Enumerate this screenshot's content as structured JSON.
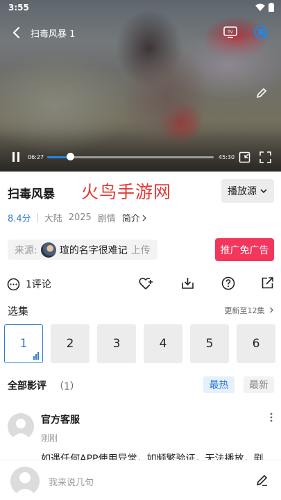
{
  "status": {
    "time": "3:55"
  },
  "player": {
    "title": "扫毒风暴 1",
    "current_time": "06:27",
    "duration": "45:30",
    "progress": 0.14
  },
  "show": {
    "title": "扫毒风暴",
    "watermark": "火鸟手游网",
    "source_button": "播放源",
    "score": "8.4分",
    "region": "大陆",
    "year": "2025",
    "genre": "剧情",
    "intro": "简介"
  },
  "uploader": {
    "label": "来源:",
    "name": "瑄的名字很难记",
    "suffix": "上传",
    "promo_button": "推广免广告"
  },
  "actions": {
    "comment_count": "1评论"
  },
  "episodes": {
    "heading": "选集",
    "update_note": "更新至12集",
    "items": [
      "1",
      "2",
      "3",
      "4",
      "5",
      "6"
    ],
    "active_index": 0
  },
  "reviews": {
    "heading": "全部影评",
    "count": "（1）",
    "sort_hot": "最热",
    "sort_new": "最新",
    "items": [
      {
        "user": "官方客服",
        "time": "刚刚",
        "text": "如遇任何APP使用异常，如频繁验证，无法播放，剧"
      }
    ]
  },
  "composer": {
    "placeholder": "我来说几句"
  },
  "colors": {
    "accent": "#2e7bd6",
    "promo": "#f4365c",
    "watermark": "#e53935"
  }
}
